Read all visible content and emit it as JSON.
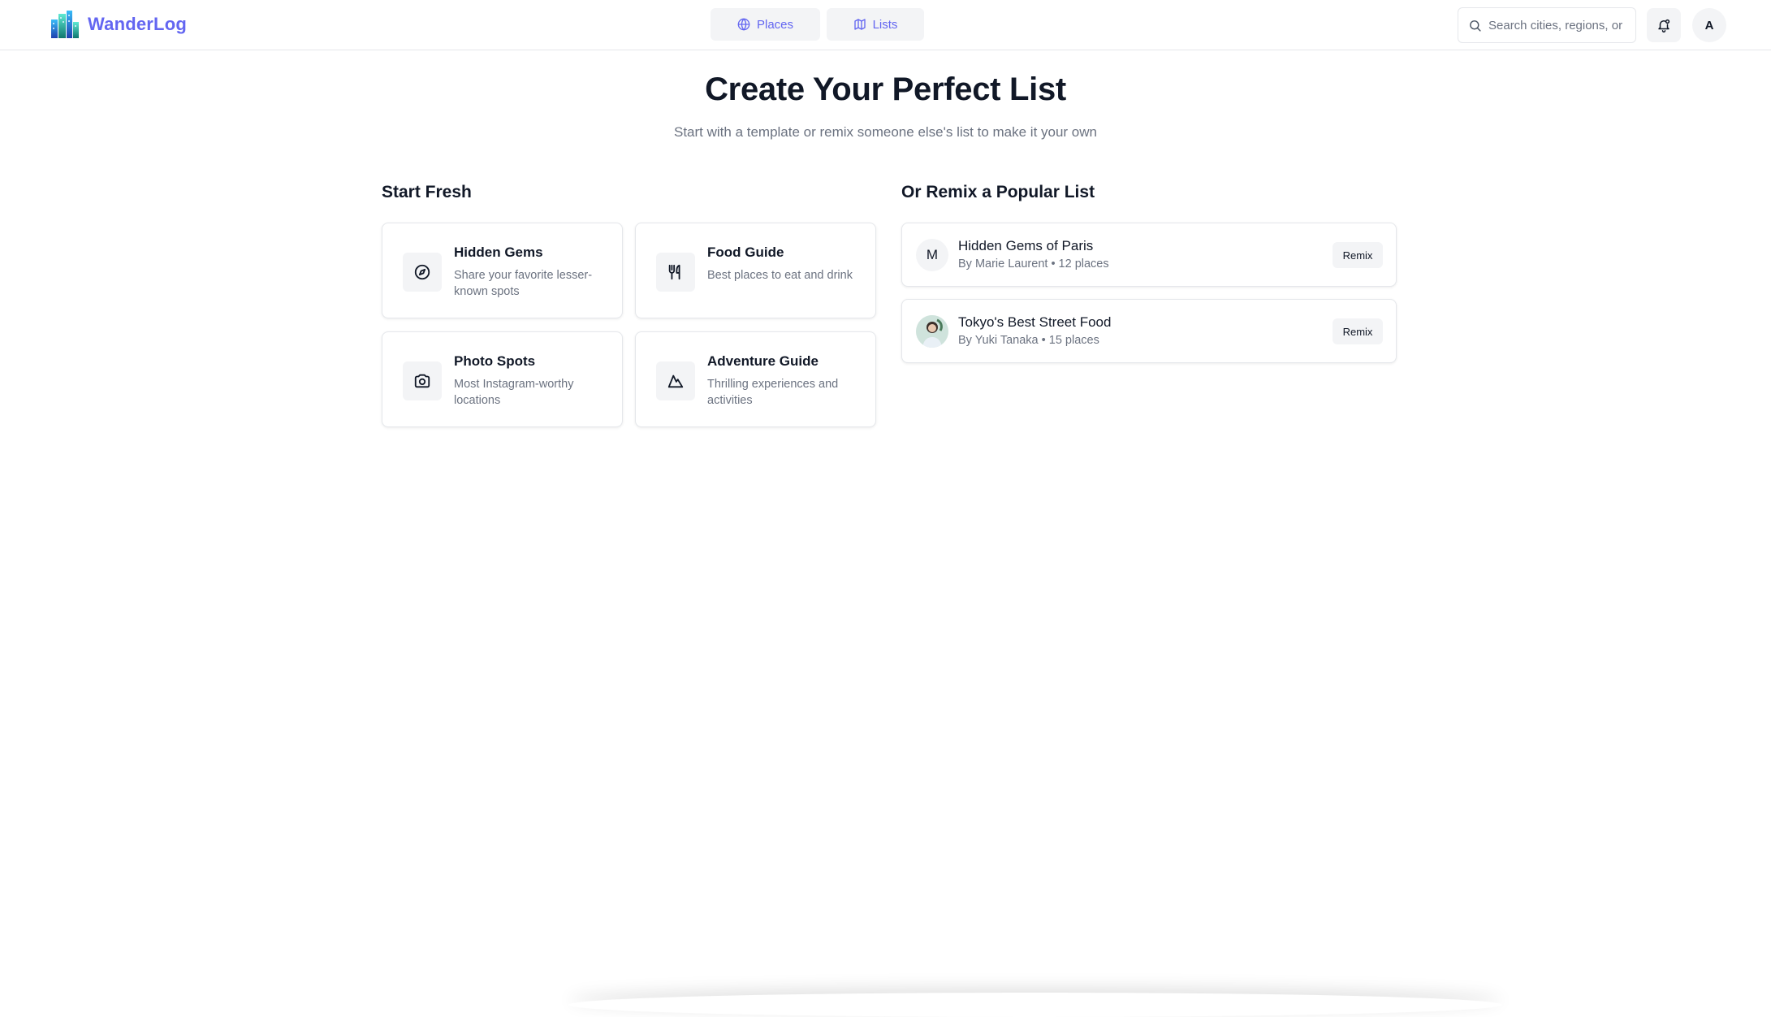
{
  "header": {
    "brand_name": "WanderLog",
    "nav": [
      {
        "label": "Places",
        "icon": "globe-icon"
      },
      {
        "label": "Lists",
        "icon": "map-icon"
      }
    ],
    "search": {
      "placeholder": "Search cities, regions, or"
    },
    "avatar_initial": "A"
  },
  "hero": {
    "title": "Create Your Perfect List",
    "subtitle": "Start with a template or remix someone else's list to make it your own"
  },
  "start_fresh": {
    "title": "Start Fresh",
    "templates": [
      {
        "title": "Hidden Gems",
        "description": "Share your favorite lesser-known spots",
        "icon": "compass-icon"
      },
      {
        "title": "Food Guide",
        "description": "Best places to eat and drink",
        "icon": "utensils-icon"
      },
      {
        "title": "Photo Spots",
        "description": "Most Instagram-worthy locations",
        "icon": "camera-icon"
      },
      {
        "title": "Adventure Guide",
        "description": "Thrilling experiences and activities",
        "icon": "mountain-icon"
      }
    ]
  },
  "remix": {
    "title": "Or Remix a Popular List",
    "lists": [
      {
        "avatar": "M",
        "title": "Hidden Gems of Paris",
        "meta": "By Marie Laurent • 12 places",
        "button": "Remix"
      },
      {
        "avatar": "",
        "title": "Tokyo's Best Street Food",
        "meta": "By Yuki Tanaka • 15 places",
        "button": "Remix"
      }
    ]
  },
  "colors": {
    "accent": "#6366f1",
    "muted_text": "#6b7280",
    "surface": "#f3f4f6",
    "border": "#e5e7eb"
  }
}
